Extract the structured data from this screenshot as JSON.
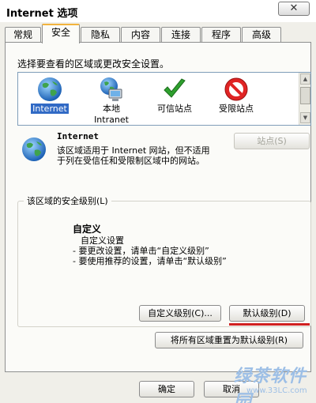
{
  "window": {
    "title": "Internet 选项",
    "close_glyph": "✕"
  },
  "tabs": [
    {
      "label": "常规"
    },
    {
      "label": "安全"
    },
    {
      "label": "隐私"
    },
    {
      "label": "内容"
    },
    {
      "label": "连接"
    },
    {
      "label": "程序"
    },
    {
      "label": "高级"
    }
  ],
  "active_tab": "安全",
  "zones": {
    "prompt": "选择要查看的区域或更改安全设置。",
    "items": [
      {
        "label": "Internet",
        "icon": "globe-icon",
        "selected": true
      },
      {
        "label": "本地",
        "label2": "Intranet",
        "icon": "local-intranet-icon"
      },
      {
        "label": "可信站点",
        "icon": "checkmark-icon"
      },
      {
        "label": "受限站点",
        "icon": "restricted-icon"
      }
    ]
  },
  "zone_info": {
    "title": "Internet",
    "description": "该区域适用于 Internet 网站，但不适用于列在受信任和受限制区域中的网站。",
    "sites_button": "站点(S)"
  },
  "security_level": {
    "group_label": "该区域的安全级别(L)",
    "title": "自定义",
    "lines": [
      "自定义设置",
      " - 要更改设置，请单击“自定义级别”",
      " - 要使用推荐的设置，请单击“默认级别”"
    ],
    "custom_button": "自定义级别(C)...",
    "default_button": "默认级别(D)",
    "reset_all_button": "将所有区域重置为默认级别(R)"
  },
  "footer": {
    "ok_button": "确定",
    "cancel_button": "取消"
  },
  "watermark": {
    "text": "绿茶软件园",
    "url": "www.33LC.com"
  },
  "colors": {
    "selection": "#316ac5",
    "active_tab_accent": "#f2b33d",
    "highlight_underline": "#d02020"
  }
}
